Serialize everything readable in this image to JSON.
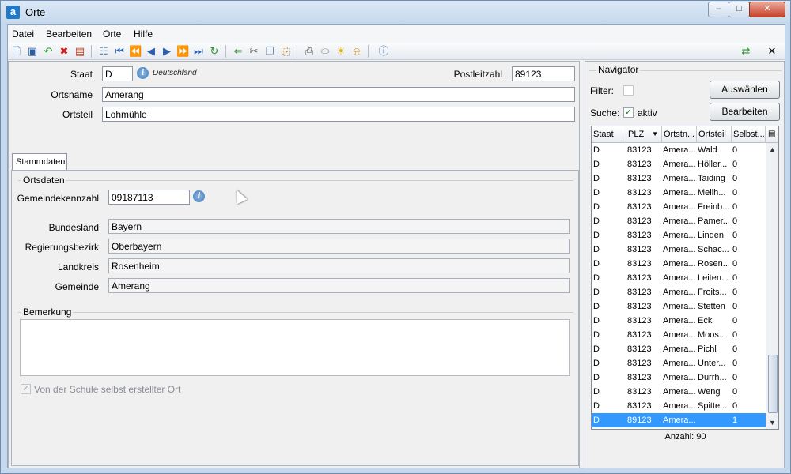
{
  "window": {
    "app_icon_letter": "a",
    "title": "Orte",
    "min_glyph": "–",
    "max_glyph": "□",
    "close_glyph": "✕"
  },
  "menu": [
    {
      "label": "Datei"
    },
    {
      "label": "Bearbeiten"
    },
    {
      "label": "Orte"
    },
    {
      "label": "Hilfe"
    }
  ],
  "toolbar": {
    "icons": [
      "new-icon",
      "save-icon",
      "undo-icon",
      "delete-icon",
      "properties-icon",
      "clipboard-icon",
      "first-record-icon",
      "previous-page-icon",
      "previous-record-icon",
      "next-record-icon",
      "next-page-icon",
      "last-record-icon",
      "refresh-icon",
      "back-arrow-icon",
      "cut-icon",
      "copy-icon",
      "paste-icon",
      "print-icon",
      "disk-icon",
      "idea-icon",
      "bell-icon",
      "help-icon"
    ],
    "right_icons": [
      "sync-icon",
      "close-icon"
    ]
  },
  "form": {
    "staat_label": "Staat",
    "staat_value": "D",
    "staat_hint": "Deutschland",
    "plz_label": "Postleitzahl",
    "plz_value": "89123",
    "ortsname_label": "Ortsname",
    "ortsname_value": "Amerang",
    "ortsteil_label": "Ortsteil",
    "ortsteil_value": "Lohmühle",
    "tab_label": "Stammdaten",
    "ortsdaten_title": "Ortsdaten",
    "gemeindekennzahl_label": "Gemeindekennzahl",
    "gemeindekennzahl_value": "09187113",
    "bundesland_label": "Bundesland",
    "bundesland_value": "Bayern",
    "regierungsbezirk_label": "Regierungsbezirk",
    "regierungsbezirk_value": "Oberbayern",
    "landkreis_label": "Landkreis",
    "landkreis_value": "Rosenheim",
    "gemeinde_label": "Gemeinde",
    "gemeinde_value": "Amerang",
    "bemerkung_title": "Bemerkung",
    "bemerkung_value": "",
    "checkbox_label": "Von der Schule selbst erstellter Ort",
    "checkbox_checked": true
  },
  "navigator": {
    "title": "Navigator",
    "filter_label": "Filter:",
    "search_label": "Suche:",
    "search_checkbox_label": "aktiv",
    "select_button": "Auswählen",
    "edit_button": "Bearbeiten",
    "columns": [
      "Staat",
      "PLZ",
      "Ortstn...",
      "Ortsteil",
      "Selbst..."
    ],
    "rows": [
      [
        "D",
        "83123",
        "Amera...",
        "Wald",
        "0"
      ],
      [
        "D",
        "83123",
        "Amera...",
        "Höller...",
        "0"
      ],
      [
        "D",
        "83123",
        "Amera...",
        "Taiding",
        "0"
      ],
      [
        "D",
        "83123",
        "Amera...",
        "Meilh...",
        "0"
      ],
      [
        "D",
        "83123",
        "Amera...",
        "Freinb...",
        "0"
      ],
      [
        "D",
        "83123",
        "Amera...",
        "Pamer...",
        "0"
      ],
      [
        "D",
        "83123",
        "Amera...",
        "Linden",
        "0"
      ],
      [
        "D",
        "83123",
        "Amera...",
        "Schac...",
        "0"
      ],
      [
        "D",
        "83123",
        "Amera...",
        "Rosen...",
        "0"
      ],
      [
        "D",
        "83123",
        "Amera...",
        "Leiten...",
        "0"
      ],
      [
        "D",
        "83123",
        "Amera...",
        "Froits...",
        "0"
      ],
      [
        "D",
        "83123",
        "Amera...",
        "Stetten",
        "0"
      ],
      [
        "D",
        "83123",
        "Amera...",
        "Eck",
        "0"
      ],
      [
        "D",
        "83123",
        "Amera...",
        "Moos...",
        "0"
      ],
      [
        "D",
        "83123",
        "Amera...",
        "Pichl",
        "0"
      ],
      [
        "D",
        "83123",
        "Amera...",
        "Unter...",
        "0"
      ],
      [
        "D",
        "83123",
        "Amera...",
        "Durrh...",
        "0"
      ],
      [
        "D",
        "83123",
        "Amera...",
        "Weng",
        "0"
      ],
      [
        "D",
        "83123",
        "Amera...",
        "Spitte...",
        "0"
      ],
      [
        "D",
        "89123",
        "Amera...",
        "",
        "1"
      ]
    ],
    "selected_row": 19,
    "count_label": "Anzahl: 90",
    "nav_icons": [
      "clipboard-icon",
      "first-record-icon",
      "previous-page-icon",
      "previous-record-icon",
      "next-record-icon",
      "next-page-icon",
      "last-record-icon",
      "refresh-icon"
    ]
  }
}
